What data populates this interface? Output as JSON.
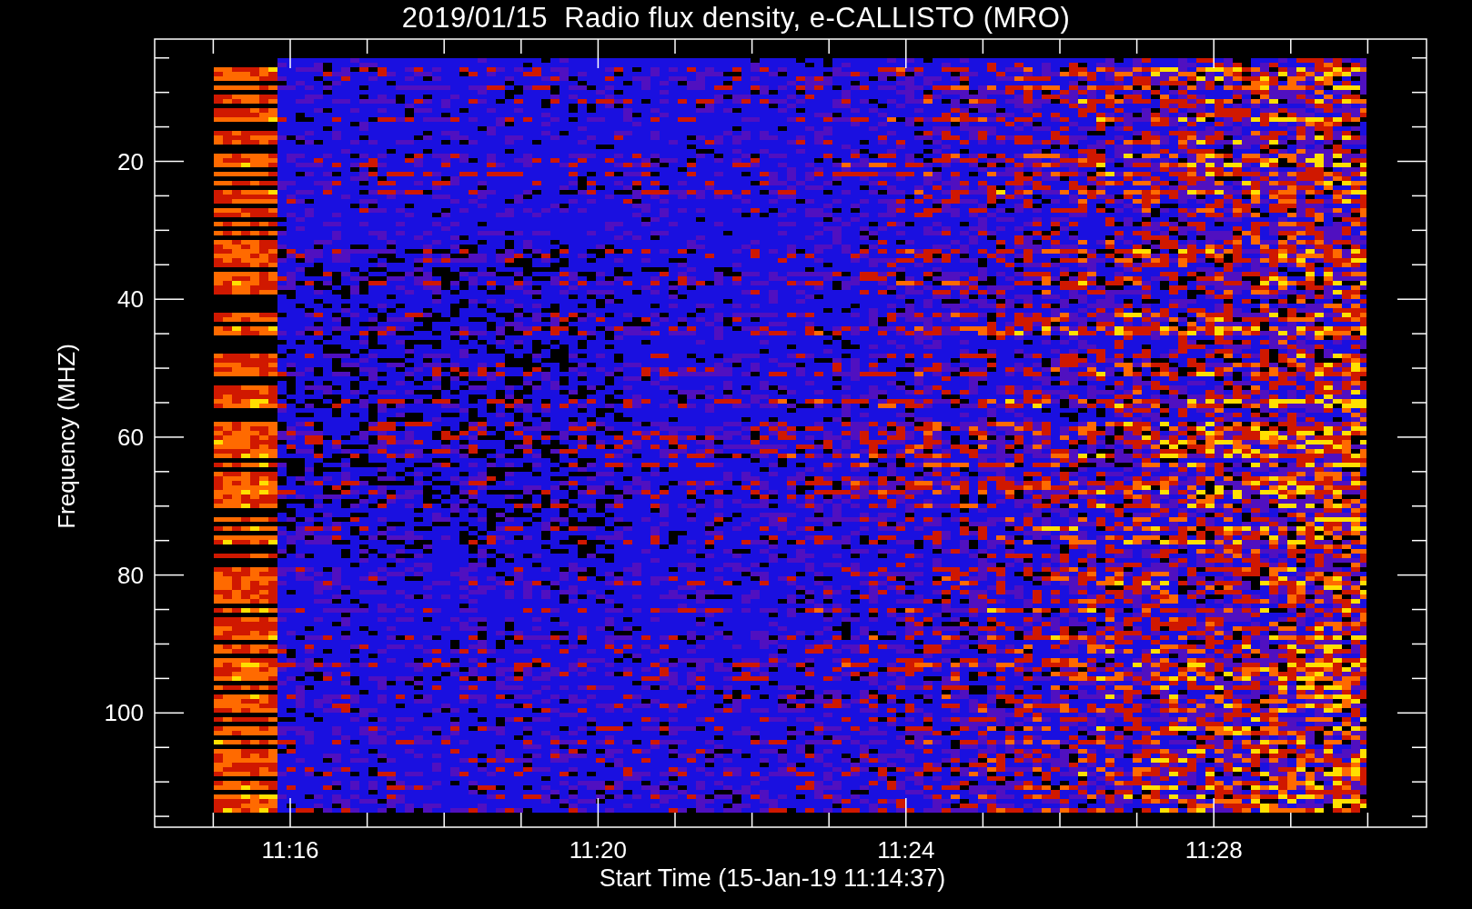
{
  "title": "2019/01/15  Radio flux density, e-CALLISTO (MRO)",
  "plot": {
    "ylabel": "Frequency (MHZ)",
    "xlabel": "Start Time (15-Jan-19 11:14:37)",
    "yticks": [
      "20",
      "40",
      "60",
      "80",
      "100"
    ],
    "xticks": [
      "11:16",
      "11:20",
      "11:24",
      "11:28"
    ]
  }
}
